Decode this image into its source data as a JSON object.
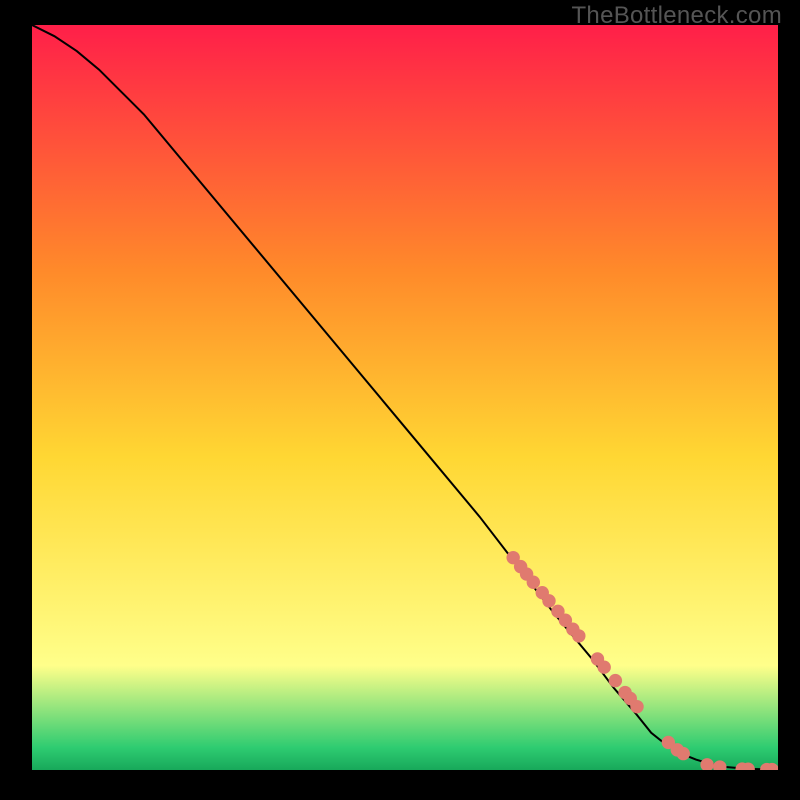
{
  "watermark": "TheBottleneck.com",
  "chart_data": {
    "type": "line",
    "title": "",
    "xlabel": "",
    "ylabel": "",
    "xlim": [
      0,
      100
    ],
    "ylim": [
      0,
      100
    ],
    "grid": false,
    "legend": false,
    "background_gradient": {
      "top": "#ff1f49",
      "upper_mid": "#ff8a2a",
      "mid": "#ffd733",
      "lower_mid": "#ffff8a",
      "near_bottom": "#2ecc71",
      "bottom": "#18a85a"
    },
    "series": [
      {
        "name": "curve",
        "color": "#000000",
        "x": [
          0,
          3,
          6,
          9,
          12,
          15,
          20,
          30,
          40,
          50,
          60,
          70,
          75,
          78,
          81,
          83,
          85,
          87,
          89,
          91,
          93,
          96,
          100
        ],
        "y": [
          100,
          98.5,
          96.5,
          94,
          91,
          88,
          82,
          70,
          58,
          46,
          34,
          21,
          15,
          11,
          7.5,
          5,
          3.4,
          2.2,
          1.4,
          0.8,
          0.4,
          0.15,
          0.05
        ]
      },
      {
        "name": "highlight-dots",
        "color": "#e07a6f",
        "x": [
          64.5,
          65.5,
          66.3,
          67.2,
          68.4,
          69.3,
          70.5,
          71.5,
          72.5,
          73.3,
          75.8,
          76.7,
          78.2,
          79.5,
          80.2,
          81.1,
          85.3,
          86.5,
          87.3,
          90.5,
          92.2,
          95.2,
          96.0,
          98.5,
          99.2
        ],
        "y": [
          28.5,
          27.3,
          26.3,
          25.2,
          23.8,
          22.7,
          21.3,
          20.1,
          18.9,
          18.0,
          14.9,
          13.8,
          12.0,
          10.4,
          9.6,
          8.5,
          3.7,
          2.7,
          2.2,
          0.7,
          0.4,
          0.12,
          0.1,
          0.06,
          0.05
        ]
      }
    ]
  }
}
